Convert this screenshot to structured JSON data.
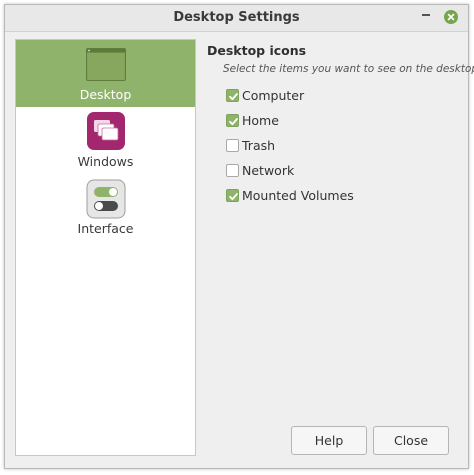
{
  "window": {
    "title": "Desktop Settings"
  },
  "sidebar": {
    "items": [
      {
        "label": "Desktop",
        "icon": "desktop-icon",
        "selected": true
      },
      {
        "label": "Windows",
        "icon": "windows-icon",
        "selected": false
      },
      {
        "label": "Interface",
        "icon": "interface-toggle-icon",
        "selected": false
      }
    ]
  },
  "content": {
    "section_title": "Desktop icons",
    "subtitle": "Select the items you want to see on the desktop:",
    "options": [
      {
        "label": "Computer",
        "checked": true
      },
      {
        "label": "Home",
        "checked": true
      },
      {
        "label": "Trash",
        "checked": false
      },
      {
        "label": "Network",
        "checked": false
      },
      {
        "label": "Mounted Volumes",
        "checked": true
      }
    ]
  },
  "buttons": {
    "help": "Help",
    "close": "Close"
  },
  "colors": {
    "accent": "#8fb36a",
    "close_button": "#76a54c",
    "windows_icon": "#a3276f",
    "window_bg": "#efefef"
  }
}
